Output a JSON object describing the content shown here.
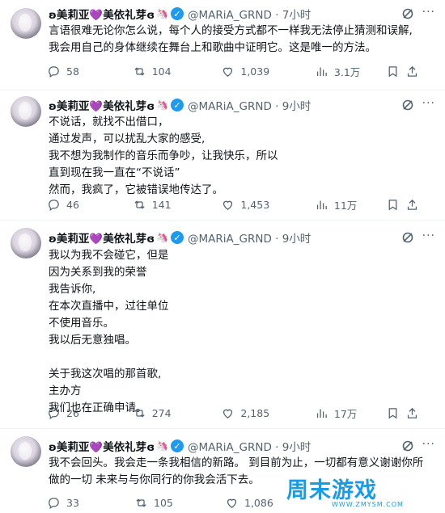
{
  "tweets": [
    {
      "name_prefix": "ʚ",
      "name_part1": "美莉亚",
      "name_heart": "💜",
      "name_part2": "美依礼芽",
      "name_suffix": "ɞ",
      "unicorn": "🦄",
      "handle": "@MARiA_GRND · 7小时",
      "lines": [
        "言语很难无论你怎么说，每个人的接受方式都不一样我无法停止猜测和误解,",
        "我会用自己的身体继续在舞台上和歌曲中证明它。这是唯一的方法。"
      ],
      "replies": "58",
      "reposts": "104",
      "likes": "1,039",
      "views": "3.1万"
    },
    {
      "name_prefix": "ʚ",
      "name_part1": "美莉亚",
      "name_heart": "💜",
      "name_part2": "美依礼芽",
      "name_suffix": "ɞ",
      "unicorn": "🦄",
      "handle": "@MARiA_GRND · 9小时",
      "lines": [
        "不说话，就找不出借口，",
        "通过发声，可以扰乱大家的感受,",
        "我不想为我制作的音乐而争吵，让我快乐，所以",
        "直到现在我一直在“不说话”",
        "然而，我疯了，它被错误地传达了。"
      ],
      "replies": "46",
      "reposts": "141",
      "likes": "1,453",
      "views": "11万"
    },
    {
      "name_prefix": "ʚ",
      "name_part1": "美莉亚",
      "name_heart": "💜",
      "name_part2": "美依礼芽",
      "name_suffix": "ɞ",
      "unicorn": "🦄",
      "handle": "@MARiA_GRND · 9小时",
      "lines": [
        "我以为我不会碰它，但是",
        "因为关系到我的荣誉",
        "我告诉你,",
        "在本次直播中，过往单位",
        "不使用音乐。",
        "我以后无意独唱。",
        "",
        "关于我这次唱的那首歌,",
        "主办方",
        "我们也在正确申请。"
      ],
      "replies": "26",
      "reposts": "274",
      "likes": "2,185",
      "views": "17万"
    },
    {
      "name_prefix": "ʚ",
      "name_part1": "美莉亚",
      "name_heart": "💜",
      "name_part2": "美依礼芽",
      "name_suffix": "ɞ",
      "unicorn": "🦄",
      "handle": "@MARiA_GRND · 9小时",
      "lines": [
        "我不会回头。我会走一条我相信的新路。 到目前为止，一切都有意义谢谢你所",
        "做的一切 未来与与你同行的你我会活下去。"
      ],
      "replies": "33",
      "reposts": "105",
      "likes": "1,086",
      "views": ""
    }
  ],
  "watermark": {
    "text": "周末游戏",
    "url": "WWW.ZMYSM.COM"
  },
  "colors": {
    "accent": "#1d9bf0",
    "muted": "#536471",
    "heart": "#b07bd8"
  },
  "icons": [
    "reply-icon",
    "repost-icon",
    "like-icon",
    "views-icon",
    "grok-icon",
    "more-icon",
    "verified-icon"
  ]
}
